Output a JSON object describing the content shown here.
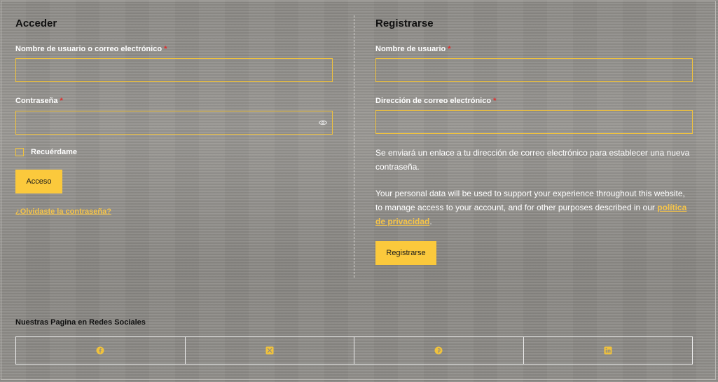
{
  "login": {
    "title": "Acceder",
    "username_label": "Nombre de usuario o correo electrónico",
    "required_mark": "*",
    "username_value": "",
    "password_label": "Contraseña",
    "password_value": "",
    "remember_label": "Recuérdame",
    "remember_checked": false,
    "submit_label": "Acceso",
    "forgot_link": "¿Olvidaste la contraseña?"
  },
  "register": {
    "title": "Registrarse",
    "username_label": "Nombre de usuario",
    "required_mark": "*",
    "username_value": "",
    "email_label": "Dirección de correo electrónico",
    "email_value": "",
    "notice": "Se enviará un enlace a tu dirección de correo electrónico para establecer una nueva contraseña.",
    "privacy_text": "Your personal data will be used to support your experience throughout this website, to manage access to your account, and for other purposes described in our",
    "privacy_link": "política de privacidad",
    "privacy_end": ".",
    "submit_label": "Registrarse"
  },
  "social": {
    "title": "Nuestras Pagina en Redes Sociales",
    "items": [
      {
        "icon": "facebook-icon"
      },
      {
        "icon": "x-twitter-icon"
      },
      {
        "icon": "pinterest-icon"
      },
      {
        "icon": "linkedin-icon"
      }
    ]
  },
  "colors": {
    "accent": "#fbc93c",
    "required": "#e02b2b",
    "text_light": "#ffffff",
    "text_dark": "#111111"
  }
}
